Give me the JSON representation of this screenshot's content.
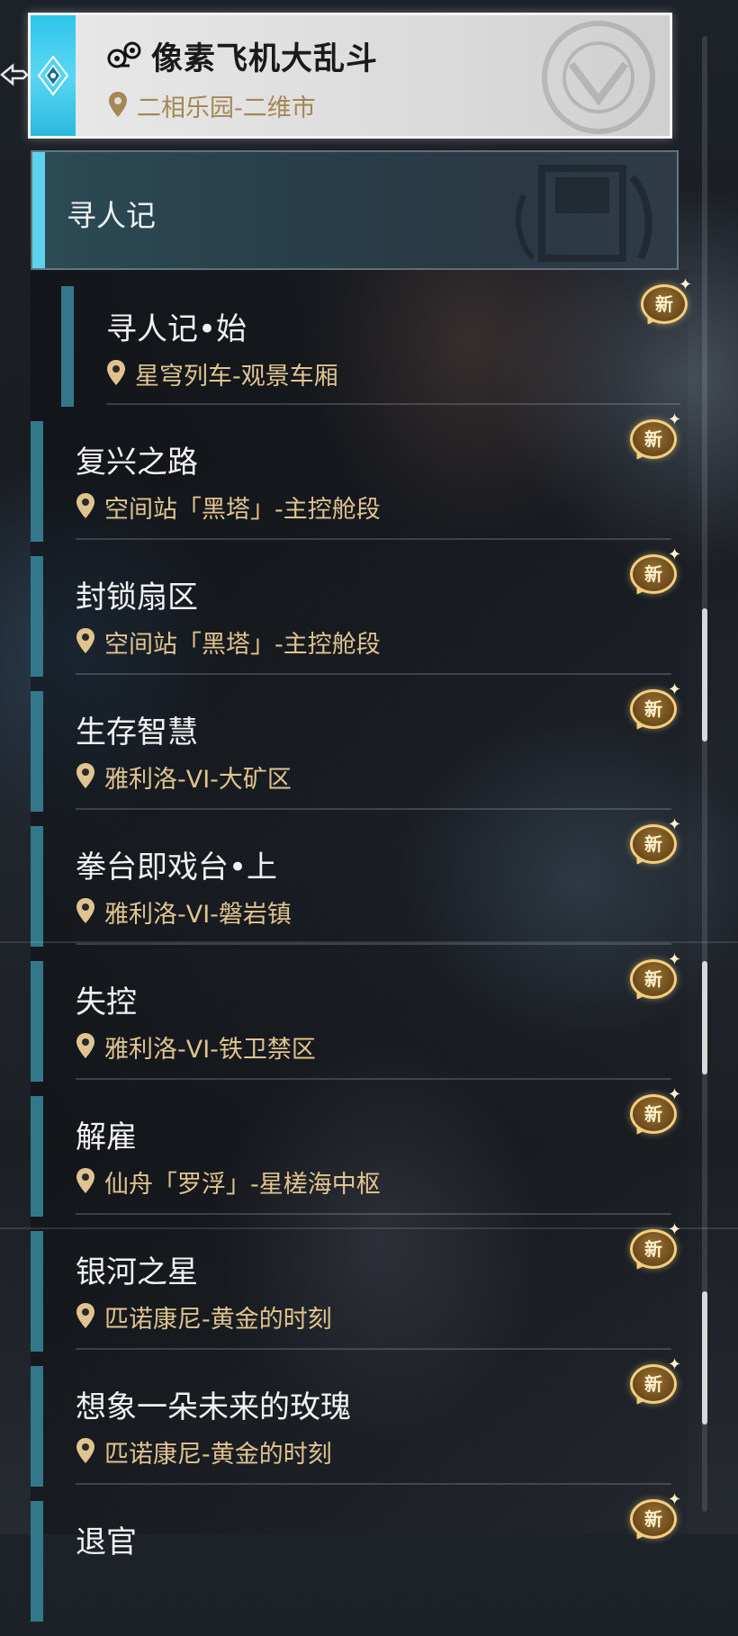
{
  "selected": {
    "title": "像素飞机大乱斗",
    "location": "二相乐园-二维市"
  },
  "category": {
    "title": "寻人记"
  },
  "sub_item": {
    "title": "寻人记•始",
    "location": "星穹列车-观景车厢",
    "badge": "新"
  },
  "items": [
    {
      "title": "复兴之路",
      "location": "空间站「黑塔」-主控舱段",
      "badge": "新"
    },
    {
      "title": "封锁扇区",
      "location": "空间站「黑塔」-主控舱段",
      "badge": "新"
    },
    {
      "title": "生存智慧",
      "location": "雅利洛-VI-大矿区",
      "badge": "新"
    },
    {
      "title": "拳台即戏台•上",
      "location": "雅利洛-VI-磐岩镇",
      "badge": "新"
    },
    {
      "title": "失控",
      "location": "雅利洛-VI-铁卫禁区",
      "badge": "新"
    },
    {
      "title": "解雇",
      "location": "仙舟「罗浮」-星槎海中枢",
      "badge": "新"
    },
    {
      "title": "银河之星",
      "location": "匹诺康尼-黄金的时刻",
      "badge": "新"
    },
    {
      "title": "想象一朵未来的玫瑰",
      "location": "匹诺康尼-黄金的时刻",
      "badge": "新"
    },
    {
      "title": "退官",
      "location": "",
      "badge": "新"
    }
  ],
  "colors": {
    "accent_cyan": "#5cd2ec",
    "item_bar": "#33788a",
    "location_gold": "#e0c48f",
    "badge_gold": "#f3cf7e"
  },
  "icons": {
    "selected_game": "controller-icon",
    "location": "location-pin-icon",
    "new_badge": "new-badge-icon"
  }
}
